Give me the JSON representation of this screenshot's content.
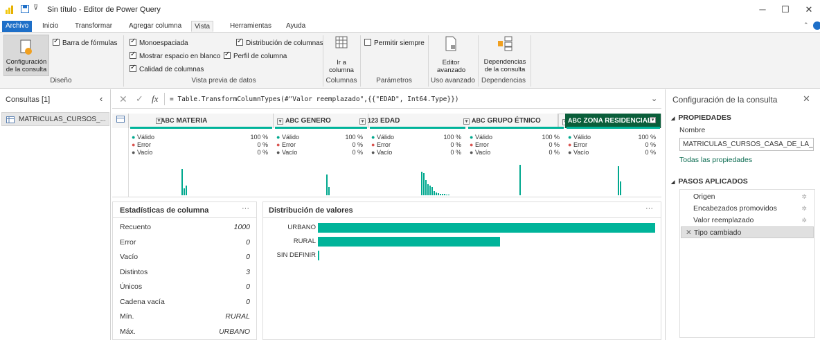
{
  "window": {
    "title": "Sin título - Editor de Power Query"
  },
  "menu": {
    "tabs": [
      "Archivo",
      "Inicio",
      "Transformar",
      "Agregar columna",
      "Vista",
      "Herramientas",
      "Ayuda"
    ],
    "active": "Vista"
  },
  "ribbon": {
    "config_label": "Configuración de la consulta",
    "group_diseno": "Diseño",
    "barra_formulas": "Barra de fórmulas",
    "monoespaciada": "Monoespaciada",
    "mostrar_espacio": "Mostrar espacio en blanco",
    "calidad_columnas": "Calidad de columnas",
    "distribucion_columnas": "Distribución de columnas",
    "perfil_columna": "Perfil de columna",
    "group_vista_previa": "Vista previa de datos",
    "ir_a_columna": "Ir a columna",
    "group_columnas": "Columnas",
    "permitir_siempre": "Permitir siempre",
    "group_parametros": "Parámetros",
    "editor_avanzado": "Editor avanzado",
    "group_uso_avanzado": "Uso avanzado",
    "dependencias": "Dependencias de la consulta",
    "group_dependencias": "Dependencias"
  },
  "queries": {
    "title": "Consultas [1]",
    "item": "MATRICULAS_CURSOS_..."
  },
  "formula": {
    "text": "= Table.TransformColumnTypes(#\"Valor reemplazado\",{{\"EDAD\", Int64.Type}})"
  },
  "columns": [
    {
      "name": "MATERIA",
      "type": "ABC"
    },
    {
      "name": "GENERO",
      "type": "ABC"
    },
    {
      "name": "EDAD",
      "type": "123"
    },
    {
      "name": "GRUPO ÉTNICO",
      "type": "ABC"
    },
    {
      "name": "ZONA RESIDENCIAL",
      "type": "ABC"
    }
  ],
  "quality": {
    "valid_label": "Válido",
    "error_label": "Error",
    "empty_label": "Vacío",
    "valid_pct": "100 %",
    "error_pct": "0 %",
    "empty_pct": "0 %"
  },
  "stats": {
    "title": "Estadísticas de columna",
    "rows": [
      {
        "label": "Recuento",
        "value": "1000"
      },
      {
        "label": "Error",
        "value": "0"
      },
      {
        "label": "Vacío",
        "value": "0"
      },
      {
        "label": "Distintos",
        "value": "3"
      },
      {
        "label": "Únicos",
        "value": "0"
      },
      {
        "label": "Cadena vacía",
        "value": "0"
      },
      {
        "label": "Mín.",
        "value": "RURAL"
      },
      {
        "label": "Máx.",
        "value": "URBANO"
      }
    ]
  },
  "distribution": {
    "title": "Distribución de valores",
    "items": [
      {
        "label": "URBANO",
        "value": 1.0
      },
      {
        "label": "RURAL",
        "value": 0.54
      },
      {
        "label": "SIN DEFINIR",
        "value": 0.004
      }
    ]
  },
  "settings": {
    "title": "Configuración de la consulta",
    "properties": "PROPIEDADES",
    "name_label": "Nombre",
    "name_value": "MATRICULAS_CURSOS_CASA_DE_LA_CU",
    "all_props": "Todas las propiedades",
    "steps_title": "PASOS APLICADOS",
    "steps": [
      "Origen",
      "Encabezados promovidos",
      "Valor reemplazado",
      "Tipo cambiado"
    ]
  }
}
